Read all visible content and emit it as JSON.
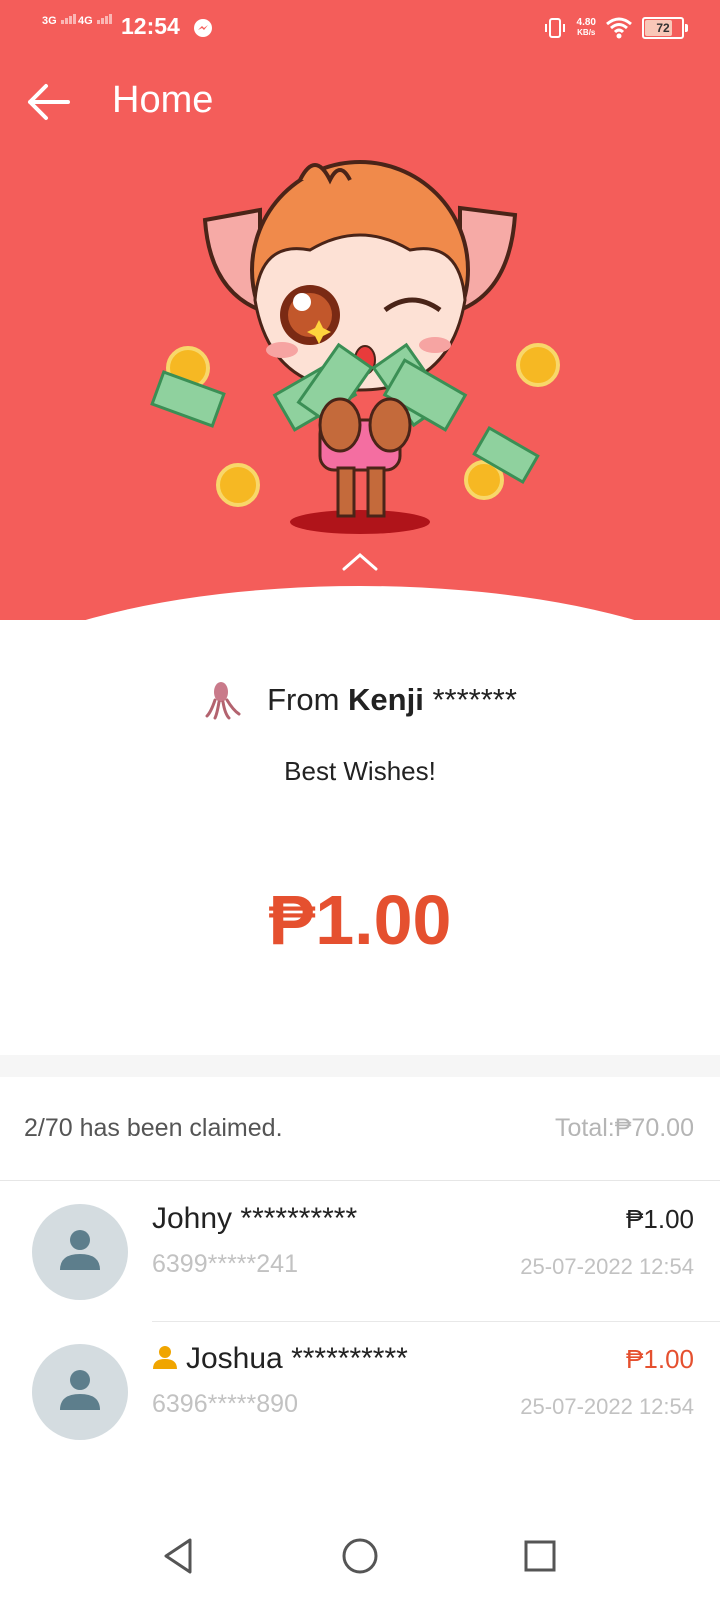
{
  "status_bar": {
    "sim1": "3G",
    "sim2": "4G",
    "time": "12:54",
    "net_speed_value": "4.80",
    "net_speed_unit": "KB/s",
    "battery": "72"
  },
  "header": {
    "title": "Home"
  },
  "packet": {
    "from_prefix": "From",
    "sender_name": "Kenji",
    "sender_mask": "*******",
    "message": "Best Wishes!",
    "amount": "₱1.00"
  },
  "summary": {
    "claimed_text": "2/70 has been claimed.",
    "total_text": "Total:₱70.00"
  },
  "claims": [
    {
      "name": "Johny **********",
      "phone": "6399*****241",
      "amount": "₱1.00",
      "date": "25-07-2022 12:54",
      "best_luck": false
    },
    {
      "name": "Joshua **********",
      "phone": "6396*****890",
      "amount": "₱1.00",
      "date": "25-07-2022 12:54",
      "best_luck": true
    }
  ],
  "colors": {
    "header_bg": "#f45d5a",
    "amount_red": "#e5502f",
    "muted_gray": "#c2c2c2"
  }
}
